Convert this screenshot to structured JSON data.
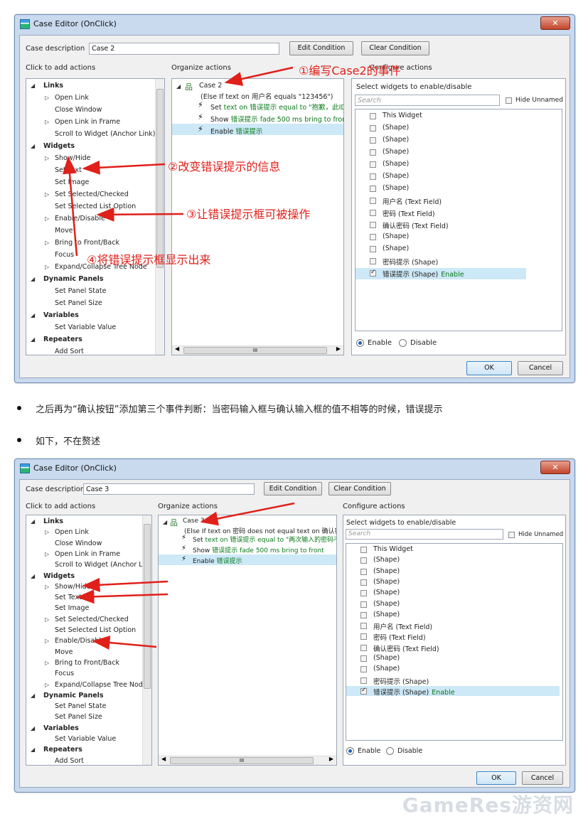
{
  "dialog1": {
    "title": "Case Editor (OnClick)",
    "close": "✕",
    "case_description_label": "Case description",
    "case_description_value": "Case 2",
    "edit_condition": "Edit Condition",
    "clear_condition": "Clear Condition",
    "click_to_add": "Click to add actions",
    "organize": "Organize actions",
    "configure": "Configure actions",
    "ok": "OK",
    "cancel": "Cancel",
    "case_name": "Case 2",
    "case_condition": "(Else If text on 用户名 equals \"123456\")",
    "action1_prefix": "Set",
    "action1_rest": "text on 错误提示 equal to \"抱歉，此ID已",
    "action2_prefix": "Show",
    "action2_rest": "错误提示 fade 500 ms bring to front",
    "action3_prefix": "Enable",
    "action3_rest": "错误提示",
    "select_widgets": "Select widgets to enable/disable",
    "search_placeholder": "Search",
    "hide_unnamed": "Hide Unnamed",
    "enable_suffix": "Enable",
    "radio_enable": "Enable",
    "radio_disable": "Disable",
    "hscroll_mark": "III",
    "notes": {
      "n1": "①编写Case2的事件",
      "n2": "②改变错误提示的信息",
      "n3": "③让错误提示框可被操作",
      "n4": "④将错误提示框显示出来"
    }
  },
  "dialog2": {
    "title": "Case Editor (OnClick)",
    "close": "✕",
    "case_description_label": "Case description",
    "case_description_value": "Case 3",
    "edit_condition": "Edit Condition",
    "clear_condition": "Clear Condition",
    "click_to_add": "Click to add actions",
    "organize": "Organize actions",
    "configure": "Configure actions",
    "ok": "OK",
    "cancel": "Cancel",
    "case_name": "Case 3",
    "case_condition": "(Else If text on 密码 does not equal text on 确认密码)",
    "action1_prefix": "Set",
    "action1_rest": "text on 错误提示 equal to \"两次输入的密码不一",
    "action2_prefix": "Show",
    "action2_rest": "错误提示 fade 500 ms bring to front",
    "action3_prefix": "Enable",
    "action3_rest": "错误提示",
    "select_widgets": "Select widgets to enable/disable",
    "search_placeholder": "Search",
    "hide_unnamed": "Hide Unnamed",
    "enable_suffix": "Enable",
    "radio_enable": "Enable",
    "radio_disable": "Disable",
    "hscroll_mark": "III"
  },
  "actions_tree": [
    {
      "label": "Links",
      "header": true
    },
    {
      "label": "Open Link",
      "sub": true
    },
    {
      "label": "Close Window"
    },
    {
      "label": "Open Link in Frame",
      "sub": true
    },
    {
      "label": "Scroll to Widget (Anchor Link)"
    },
    {
      "label": "Widgets",
      "header": true
    },
    {
      "label": "Show/Hide",
      "sub": true
    },
    {
      "label": "Set Text"
    },
    {
      "label": "Set Image"
    },
    {
      "label": "Set Selected/Checked",
      "sub": true
    },
    {
      "label": "Set Selected List Option"
    },
    {
      "label": "Enable/Disable",
      "sub": true
    },
    {
      "label": "Move"
    },
    {
      "label": "Bring to Front/Back",
      "sub": true
    },
    {
      "label": "Focus"
    },
    {
      "label": "Expand/Collapse Tree Node",
      "sub": true
    },
    {
      "label": "Dynamic Panels",
      "header": true
    },
    {
      "label": "Set Panel State"
    },
    {
      "label": "Set Panel Size"
    },
    {
      "label": "Variables",
      "header": true
    },
    {
      "label": "Set Variable Value"
    },
    {
      "label": "Repeaters",
      "header": true
    },
    {
      "label": "Add Sort"
    }
  ],
  "widgets_list": [
    {
      "label": "This Widget",
      "checked": false
    },
    {
      "label": "(Shape)",
      "checked": false
    },
    {
      "label": "(Shape)",
      "checked": false
    },
    {
      "label": "(Shape)",
      "checked": false
    },
    {
      "label": "(Shape)",
      "checked": false
    },
    {
      "label": "(Shape)",
      "checked": false
    },
    {
      "label": "(Shape)",
      "checked": false
    },
    {
      "label": "用户名 (Text Field)",
      "checked": false
    },
    {
      "label": "密码 (Text Field)",
      "checked": false
    },
    {
      "label": "确认密码 (Text Field)",
      "checked": false
    },
    {
      "label": "(Shape)",
      "checked": false
    },
    {
      "label": "(Shape)",
      "checked": false
    },
    {
      "label": "密码提示 (Shape)",
      "checked": false
    },
    {
      "label": "错误提示 (Shape)",
      "checked": true
    }
  ],
  "doc": {
    "para1": "之后再为“确认按钮”添加第三个事件判断：当密码输入框与确认输入框的值不相等的时候，错误提示",
    "para2": "如下，不在赘述"
  },
  "watermark": "GameRes游资网",
  "colors": {
    "note_red": "#e0201a",
    "action_green": "#0a7a1a",
    "selection": "#cde8f7"
  }
}
